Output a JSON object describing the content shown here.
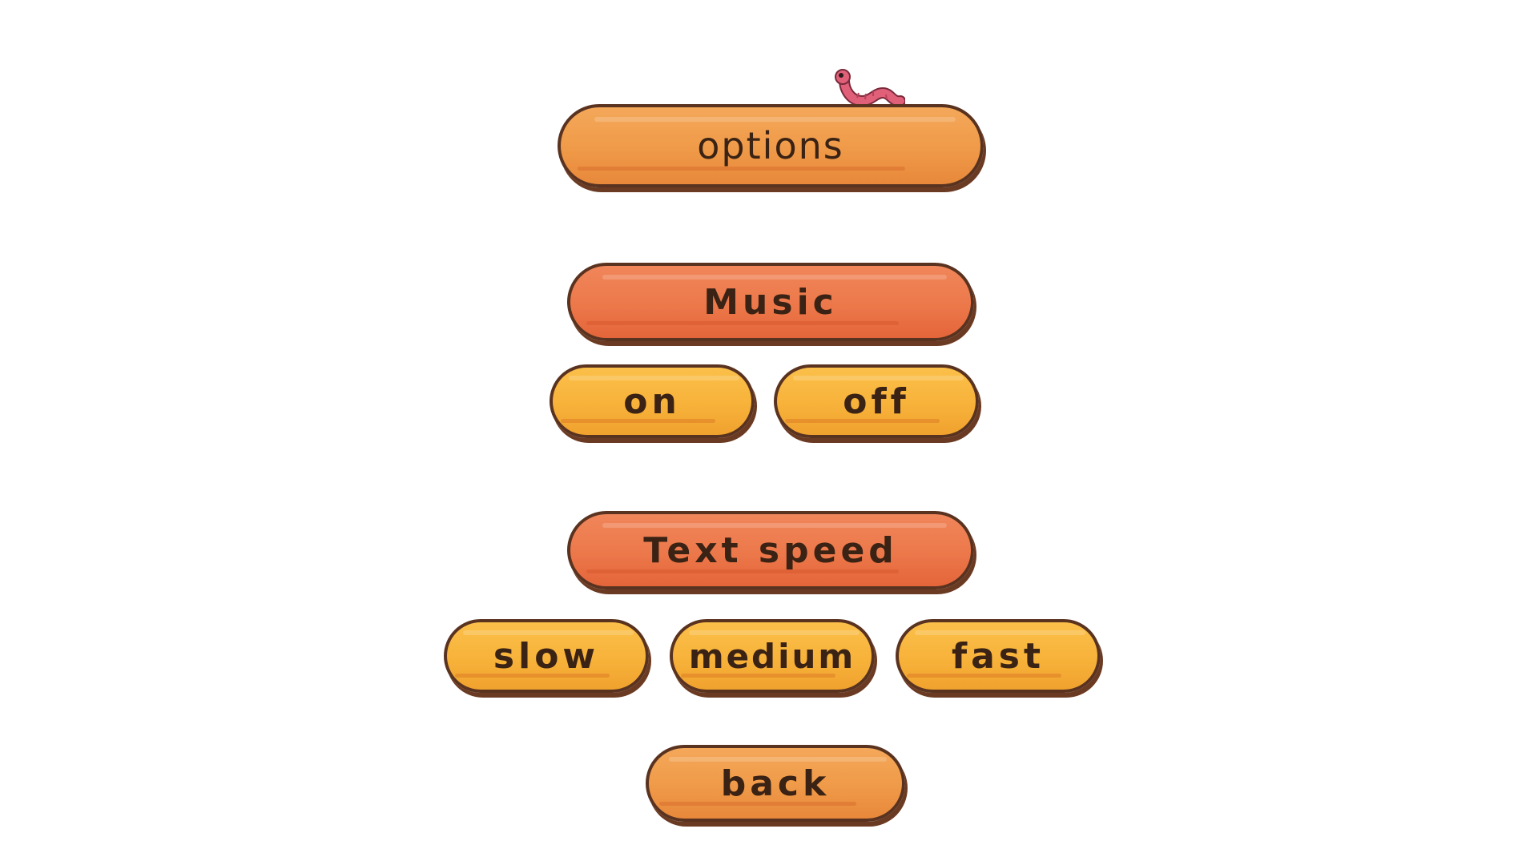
{
  "menu": {
    "title": "options",
    "music": {
      "label": "Music",
      "on_label": "on",
      "off_label": "off"
    },
    "text_speed": {
      "label": "Text speed",
      "slow_label": "slow",
      "medium_label": "medium",
      "fast_label": "fast"
    },
    "back_label": "back"
  },
  "decorations": {
    "worm_icon": "worm-icon"
  },
  "colors": {
    "plank_orange": "#ef9a48",
    "plank_red": "#ec784a",
    "plank_yellow": "#f7b23a",
    "outline": "#5a3320",
    "text": "#3a2214",
    "worm": "#e0607a"
  }
}
